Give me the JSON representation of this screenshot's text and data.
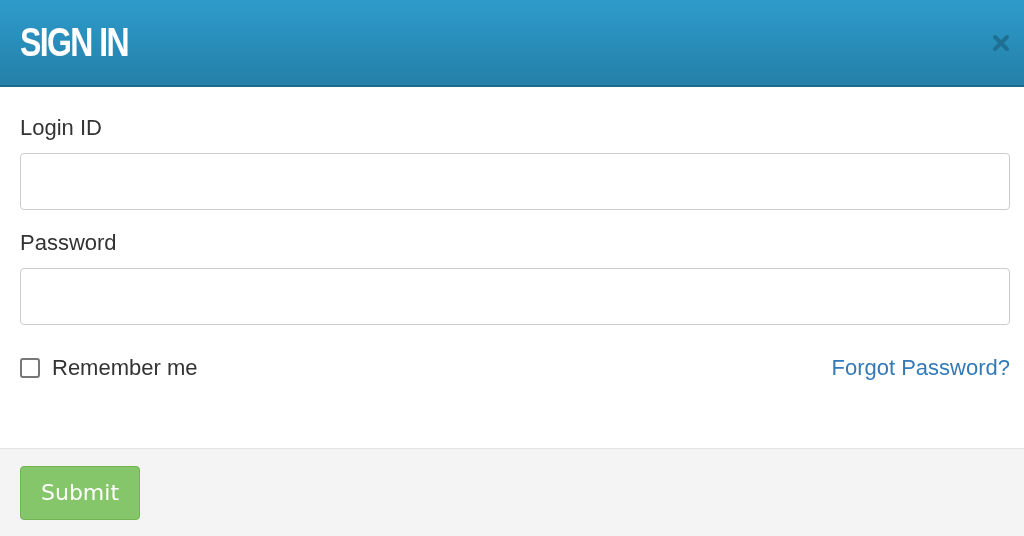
{
  "dialog": {
    "title": "SIGN IN"
  },
  "fields": [
    {
      "label": "Login ID"
    },
    {
      "label": "Password"
    }
  ],
  "remember": {
    "label": "Remember me",
    "checked": false
  },
  "forgot_link": "Forgot Password?",
  "submit": "Submit"
}
